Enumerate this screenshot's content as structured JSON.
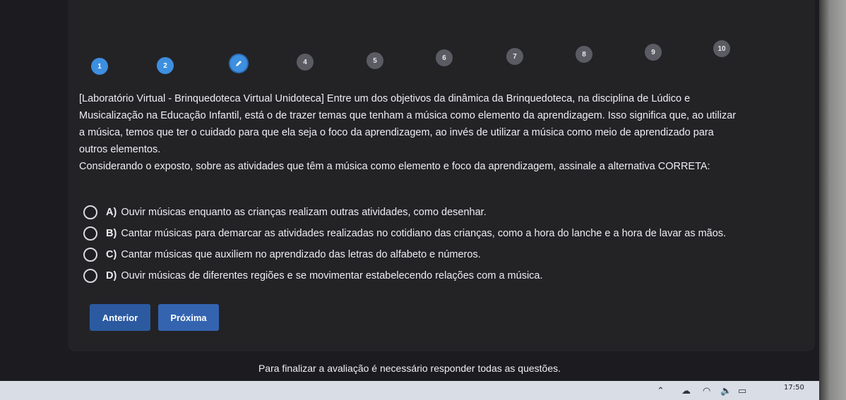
{
  "steps": [
    {
      "label": "1",
      "state": "done"
    },
    {
      "label": "2",
      "state": "done"
    },
    {
      "label": "",
      "state": "current",
      "icon": "pencil-icon"
    },
    {
      "label": "4",
      "state": "pending"
    },
    {
      "label": "5",
      "state": "pending"
    },
    {
      "label": "6",
      "state": "pending"
    },
    {
      "label": "7",
      "state": "pending"
    },
    {
      "label": "8",
      "state": "pending"
    },
    {
      "label": "9",
      "state": "pending"
    },
    {
      "label": "10",
      "state": "pending"
    }
  ],
  "question": {
    "paragraph1": "[Laboratório Virtual - Brinquedoteca Virtual Unidoteca] Entre um dos objetivos da dinâmica da Brinquedoteca, na disciplina de Lúdico e Musicalização na Educação Infantil, está o de trazer temas que tenham a música como elemento da aprendizagem. Isso significa que, ao utilizar a música, temos que ter o cuidado para que ela seja o foco da aprendizagem, ao invés de utilizar a música como meio de aprendizado para outros elementos.",
    "paragraph2": "Considerando o exposto, sobre as atividades que têm a música como elemento e foco da aprendizagem, assinale a alternativa CORRETA:"
  },
  "options": [
    {
      "letter": "A)",
      "text": "Ouvir músicas enquanto as crianças realizam outras atividades, como desenhar."
    },
    {
      "letter": "B)",
      "text": "Cantar músicas para demarcar as atividades realizadas no cotidiano das crianças, como a hora do lanche e a hora de lavar as mãos."
    },
    {
      "letter": "C)",
      "text": "Cantar músicas que auxiliem no aprendizado das letras do alfabeto e números."
    },
    {
      "letter": "D)",
      "text": "Ouvir músicas de diferentes regiões e se movimentar estabelecendo relações com a música."
    }
  ],
  "nav": {
    "prev_label": "Anterior",
    "next_label": "Próxima"
  },
  "footer": {
    "message": "Para finalizar a avaliação é necessário responder todas as questões."
  },
  "taskbar": {
    "time": "17:50"
  },
  "colors": {
    "accent": "#3d8fe0",
    "button": "#2f5fa6",
    "background": "#1c1c20"
  }
}
